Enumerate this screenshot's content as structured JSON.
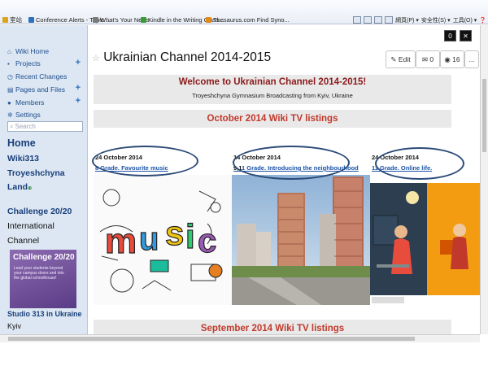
{
  "browser": {
    "favorites": [
      {
        "label": "室站",
        "color": "#d9a520"
      },
      {
        "label": "Conference Alerts - Topic ...",
        "color": "#2f6fbf"
      },
      {
        "label": "What's Your News",
        "color": "#7a7a7a"
      },
      {
        "label": "Kindle in the Writing Class...",
        "color": "#3a9a3a"
      },
      {
        "label": "Thesaurus.com  Find Syno...",
        "color": "#e08a1e"
      }
    ],
    "commands": [
      "網頁(P) ▾",
      "安全性(S) ▾",
      "工具(O) ▾"
    ],
    "help_icon": "help-icon"
  },
  "sidebar": {
    "nav": [
      {
        "label": "Wiki Home",
        "icon": "home-icon",
        "glyph": "⌂",
        "plus": false
      },
      {
        "label": "Projects",
        "icon": "projects-icon",
        "glyph": "▪",
        "plus": true
      },
      {
        "label": "Recent Changes",
        "icon": "clock-icon",
        "glyph": "◷",
        "plus": false
      },
      {
        "label": "Pages and Files",
        "icon": "file-icon",
        "glyph": "▤",
        "plus": true
      },
      {
        "label": "Members",
        "icon": "user-icon",
        "glyph": "●",
        "plus": true
      },
      {
        "label": "Settings",
        "icon": "gear-icon",
        "glyph": "✲",
        "plus": false
      }
    ],
    "search_placeholder": "Search",
    "home": "Home",
    "wiki313": "Wiki313",
    "troyeshchyna": "Troyeshchyna",
    "land": "Land",
    "challenge": "Challenge 20/20",
    "international": "International",
    "channel": "Channel",
    "challenge_image": {
      "title": "Challenge 20/20",
      "text": "Lead your students beyond your campus doors and into the global schoolhouse!"
    },
    "studio": "Studio 313 in Ukraine",
    "kyiv": "Kyiv"
  },
  "page": {
    "title": "Ukrainian Channel 2014-2015",
    "edit_label": "Edit",
    "comments_count": "0",
    "views_count": "16",
    "more_label": "...",
    "top_icons": [
      "0",
      "✕"
    ],
    "welcome_heading": "Welcome to Ukrainian Channel 2014-2015!",
    "welcome_sub": "Troyeshchyna Gymnasium Broadcasting from Kyiv, Ukraine",
    "section1": "October 2014 Wiki TV listings",
    "section2": "September 2014 Wiki TV listings",
    "listings": [
      {
        "date": "24 October 2014",
        "link": "8 Grade. Favourite music"
      },
      {
        "date": "14 October 2014",
        "prefix": "9,1",
        "link": "1 Grade. Introducing the neighbourhood"
      },
      {
        "date": "24 October 2014",
        "link": "11 Grade. Online life."
      }
    ],
    "music_word": "music"
  }
}
